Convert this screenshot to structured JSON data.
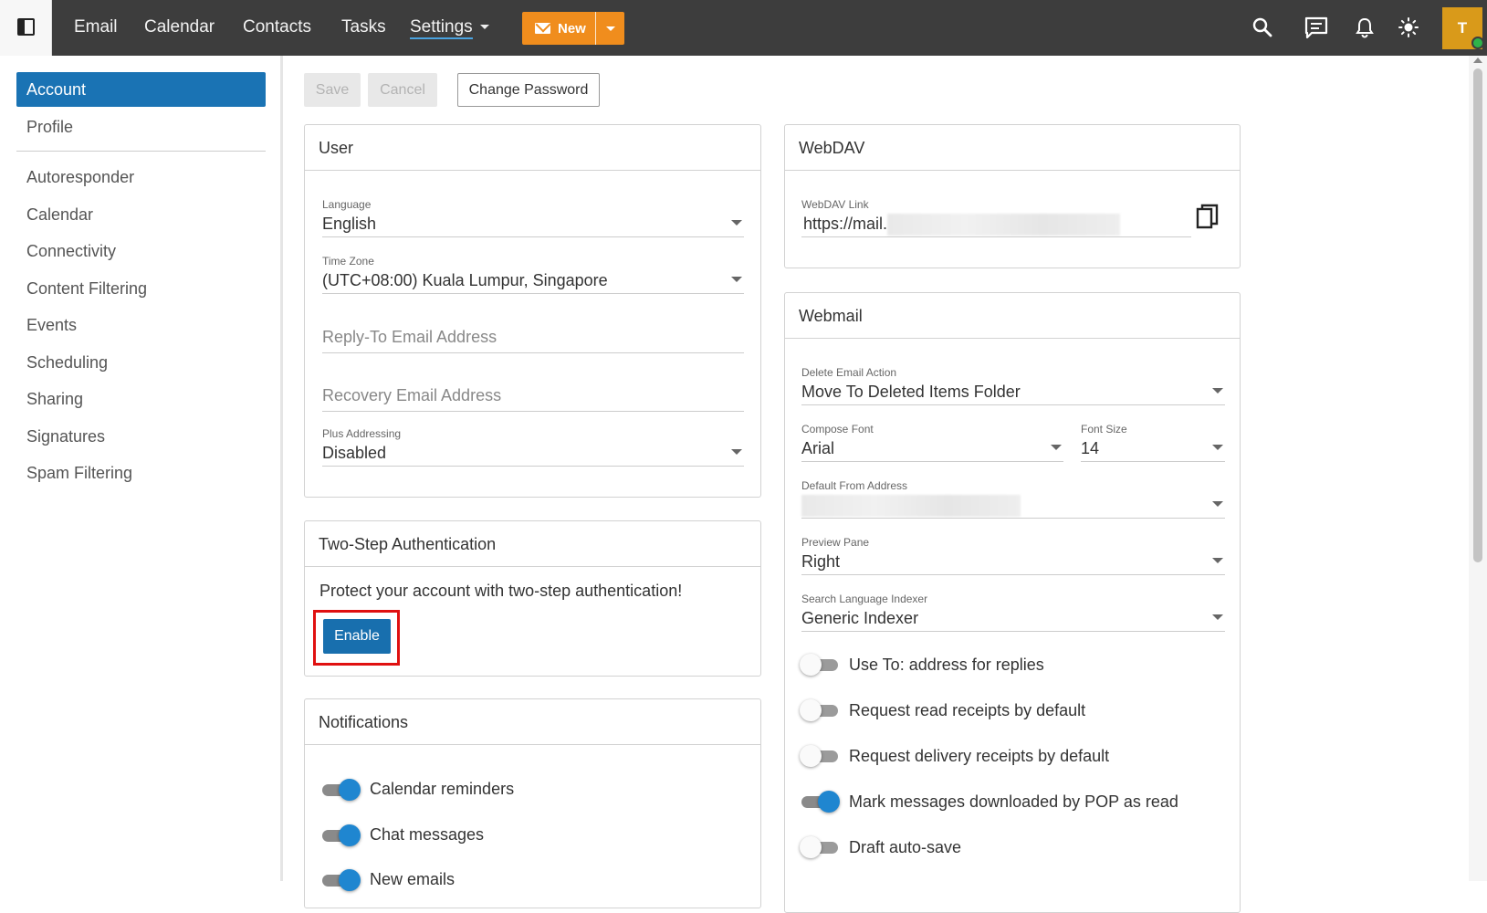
{
  "topbar": {
    "nav": [
      "Email",
      "Calendar",
      "Contacts",
      "Tasks",
      "Settings"
    ],
    "new_label": "New",
    "avatar_letter": "T"
  },
  "toolbar": {
    "save": "Save",
    "cancel": "Cancel",
    "change_password": "Change Password"
  },
  "sidebar": {
    "items": [
      "Account",
      "Profile",
      "Autoresponder",
      "Calendar",
      "Connectivity",
      "Content Filtering",
      "Events",
      "Scheduling",
      "Sharing",
      "Signatures",
      "Spam Filtering"
    ]
  },
  "user": {
    "title": "User",
    "language_label": "Language",
    "language": "English",
    "timezone_label": "Time Zone",
    "timezone": "(UTC+08:00) Kuala Lumpur, Singapore",
    "reply_to_placeholder": "Reply-To Email Address",
    "recovery_placeholder": "Recovery Email Address",
    "plus_label": "Plus Addressing",
    "plus_value": "Disabled"
  },
  "twostep": {
    "title": "Two-Step Authentication",
    "message": "Protect your account with two-step authentication!",
    "enable": "Enable"
  },
  "notifications": {
    "title": "Notifications",
    "items": [
      "Calendar reminders",
      "Chat messages",
      "New emails"
    ]
  },
  "webdav": {
    "title": "WebDAV",
    "link_label": "WebDAV Link",
    "link_prefix": "https://mail."
  },
  "webmail": {
    "title": "Webmail",
    "delete_label": "Delete Email Action",
    "delete_value": "Move To Deleted Items Folder",
    "font_label": "Compose Font",
    "font_value": "Arial",
    "size_label": "Font Size",
    "size_value": "14",
    "from_label": "Default From Address",
    "preview_label": "Preview Pane",
    "preview_value": "Right",
    "indexer_label": "Search Language Indexer",
    "indexer_value": "Generic Indexer",
    "toggles": [
      {
        "label": "Use To: address for replies",
        "on": false
      },
      {
        "label": "Request read receipts by default",
        "on": false
      },
      {
        "label": "Request delivery receipts by default",
        "on": false
      },
      {
        "label": "Mark messages downloaded by POP as read",
        "on": true
      },
      {
        "label": "Draft auto-save",
        "on": false
      }
    ]
  },
  "colors": {
    "accent": "#1a73b4",
    "new_button": "#f08d1d",
    "topbar": "#3d3d3d",
    "highlight_box": "#e01010"
  }
}
